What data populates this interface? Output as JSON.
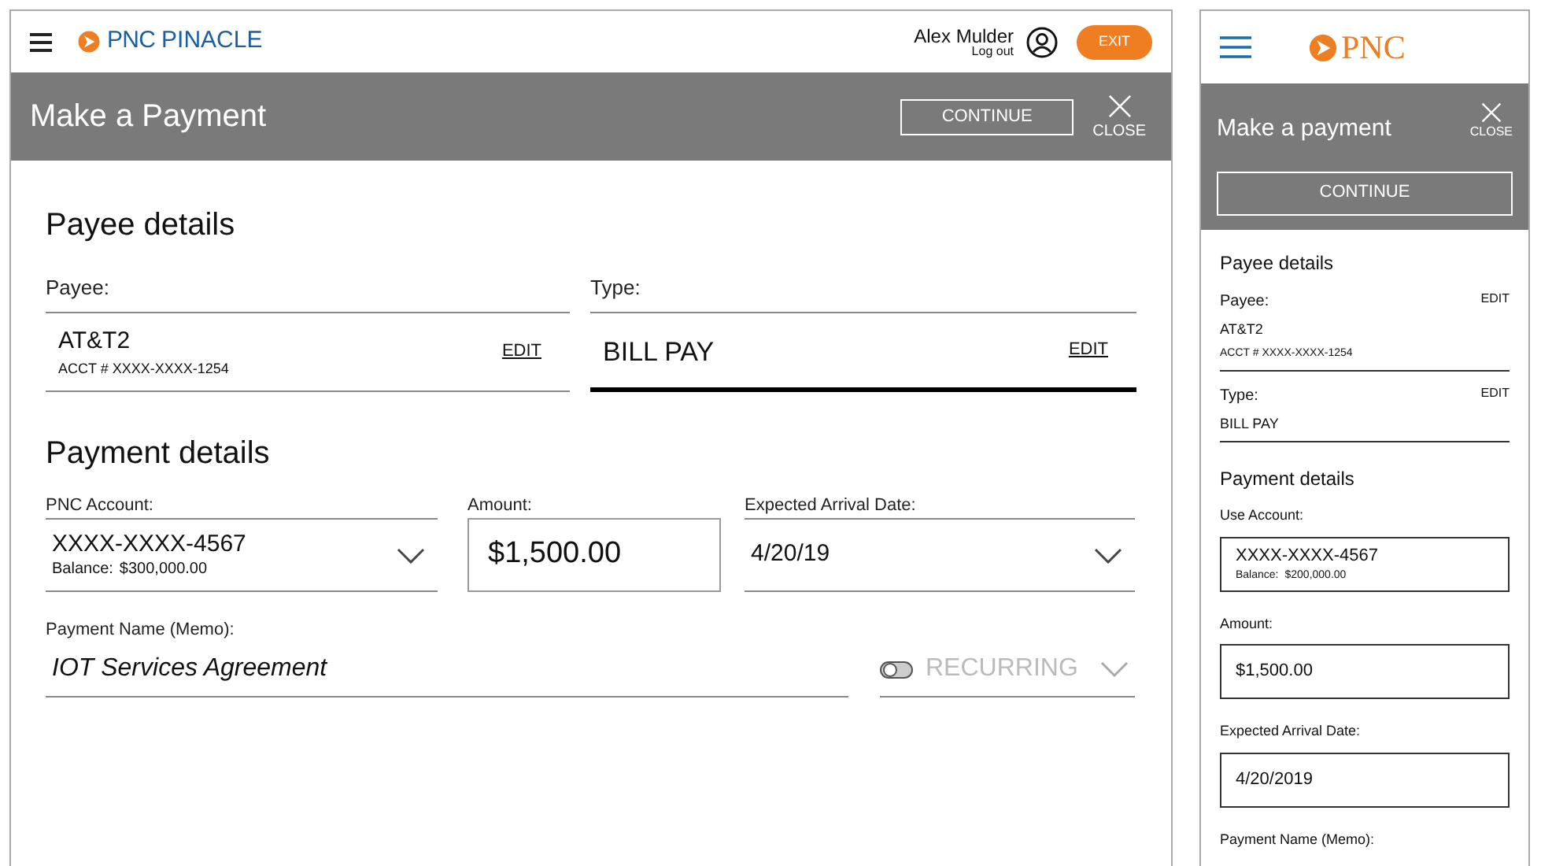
{
  "desktop": {
    "header": {
      "brand": "PNC",
      "product": "PINACLE",
      "user_name": "Alex Mulder",
      "logout": "Log out",
      "exit": "EXIT"
    },
    "title_bar": {
      "title": "Make a Payment",
      "continue": "CONTINUE",
      "close": "CLOSE"
    },
    "payee_section": {
      "heading": "Payee details",
      "fields": [
        {
          "label": "Payee:",
          "value": "AT&T2",
          "detail": "ACCT # XXXX-XXXX-1254",
          "action": "EDIT",
          "selected": false
        },
        {
          "label": "Type:",
          "value": "BILL PAY",
          "action": "EDIT",
          "selected": true
        }
      ]
    },
    "payment_section": {
      "heading": "Payment details",
      "fields": [
        {
          "kind": "dropdown",
          "label": "PNC Account:",
          "value": "XXXX-XXXX-4567",
          "detail_label": "Balance:",
          "detail_value": "$300,000.00"
        },
        {
          "kind": "box",
          "label": "Amount:",
          "value": "$1,500.00"
        },
        {
          "kind": "dropdown",
          "label": "Expected Arrival Date:",
          "value": "4/20/19"
        }
      ],
      "memo": {
        "label": "Payment Name (Memo):",
        "value": "IOT Services Agreement"
      },
      "recurring": {
        "label": "RECURRING",
        "on": false
      }
    }
  },
  "mobile": {
    "header": {
      "brand": "PNC"
    },
    "title_bar": {
      "title": "Make a payment",
      "close": "CLOSE",
      "continue": "CONTINUE"
    },
    "payee_section": {
      "heading": "Payee details",
      "fields": [
        {
          "label": "Payee:",
          "action": "EDIT",
          "value": "AT&T2",
          "detail": "ACCT # XXXX-XXXX-1254"
        },
        {
          "label": "Type:",
          "action": "EDIT",
          "value": "BILL PAY"
        }
      ]
    },
    "payment_section": {
      "heading": "Payment details",
      "fields": [
        {
          "label": "Use Account:",
          "value": "XXXX-XXXX-4567",
          "detail_label": "Balance:",
          "detail_value": "$200,000.00"
        },
        {
          "label": "Amount:",
          "value": "$1,500.00"
        },
        {
          "label": "Expected Arrival Date:",
          "value": "4/20/2019"
        },
        {
          "label": "Payment Name (Memo):"
        }
      ]
    }
  }
}
